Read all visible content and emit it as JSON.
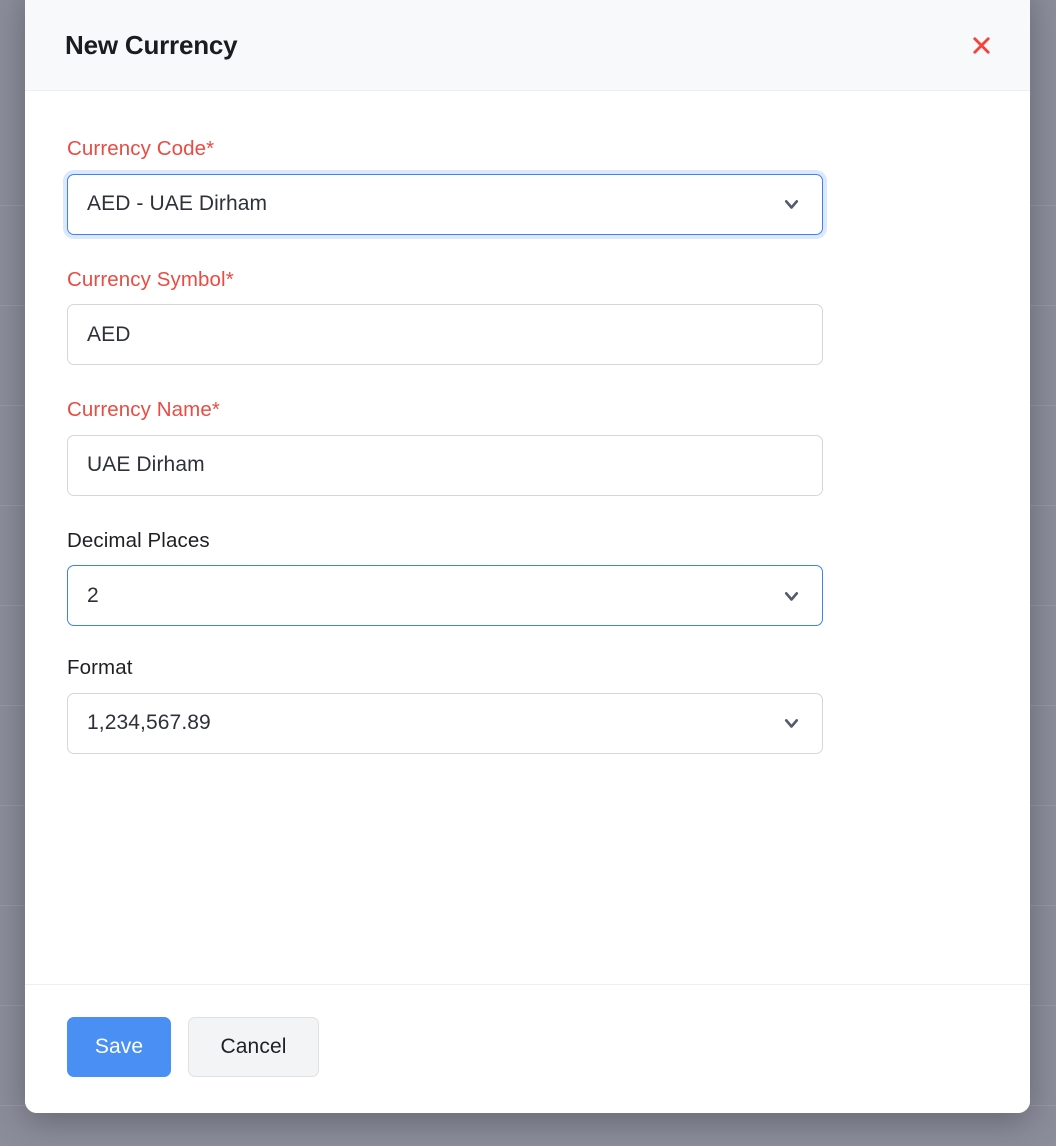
{
  "colors": {
    "overlay": "#8b8d9b",
    "required_label": "#ea4b43",
    "accent_blue": "#3b82f6",
    "primary_button": "#4a90f4",
    "close_red": "#f0453f",
    "header_bg": "#f8f9fa",
    "border_gray": "#d4d6dd"
  },
  "dialog": {
    "title": "New Currency",
    "close_icon": "close-x-icon",
    "close_label": "✕"
  },
  "fields": [
    {
      "id": "currency-code",
      "label": "Currency Code*",
      "required": true,
      "type": "select",
      "value": "AED - UAE Dirham",
      "state": "focused",
      "icon": "chevron-down-icon"
    },
    {
      "id": "currency-symbol",
      "label": "Currency Symbol*",
      "required": true,
      "type": "text",
      "value": "AED",
      "state": "default",
      "icon": ""
    },
    {
      "id": "currency-name",
      "label": "Currency Name*",
      "required": true,
      "type": "text",
      "value": "UAE Dirham",
      "state": "default",
      "icon": ""
    },
    {
      "id": "decimal-places",
      "label": "Decimal Places",
      "required": false,
      "type": "select",
      "value": "2",
      "state": "accent",
      "icon": "chevron-down-icon"
    },
    {
      "id": "format",
      "label": "Format",
      "required": false,
      "type": "select",
      "value": "1,234,567.89",
      "state": "default",
      "icon": "chevron-down-icon"
    }
  ],
  "footer": {
    "save_label": "Save",
    "cancel_label": "Cancel"
  }
}
